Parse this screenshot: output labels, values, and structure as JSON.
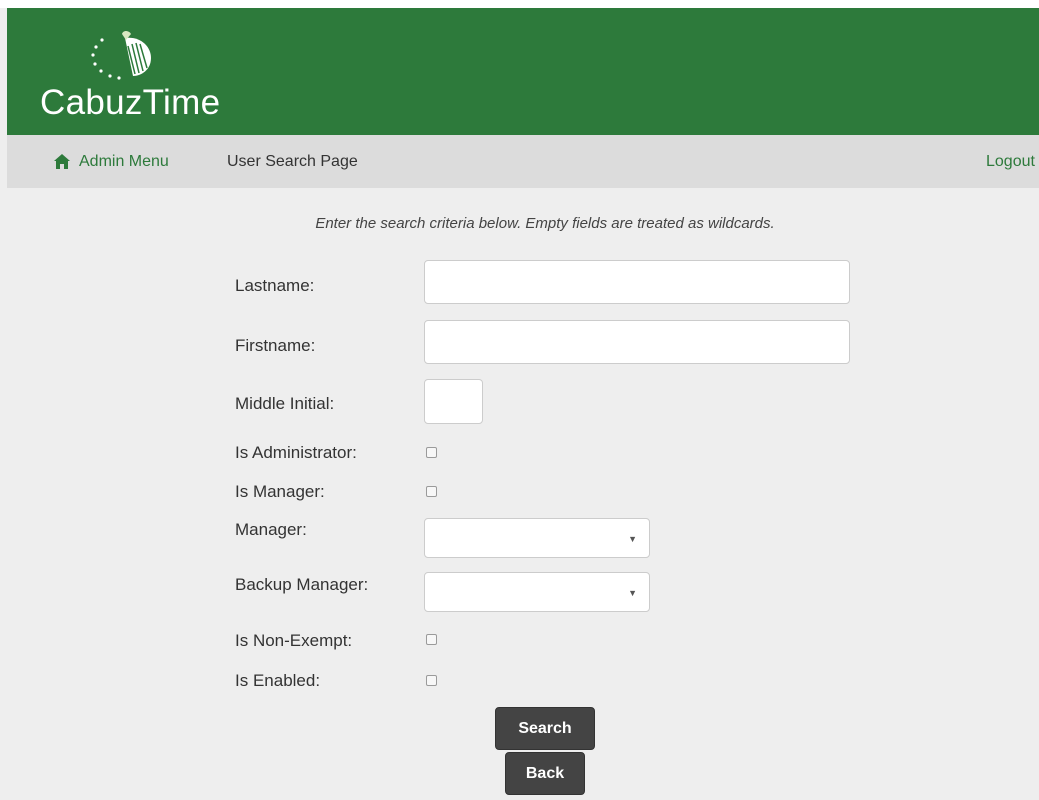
{
  "brand": {
    "name": "CabuzTime",
    "logo_icon": "cabuztime-logo-icon",
    "header_color": "#2d7a3b"
  },
  "nav": {
    "home_icon": "home-icon",
    "home_label": "Admin Menu",
    "page_title": "User Search Page",
    "logout_label": "Logout",
    "bar_color": "#dcdcdc"
  },
  "form": {
    "instructions": "Enter the search criteria below. Empty fields are treated as wildcards.",
    "lastname": {
      "label": "Lastname:",
      "value": ""
    },
    "firstname": {
      "label": "Firstname:",
      "value": ""
    },
    "middle_initial": {
      "label": "Middle Initial:",
      "value": ""
    },
    "is_administrator": {
      "label": "Is Administrator:",
      "checked": false
    },
    "is_manager": {
      "label": "Is Manager:",
      "checked": false
    },
    "manager": {
      "label": "Manager:",
      "selected": ""
    },
    "backup_manager": {
      "label": "Backup Manager:",
      "selected": ""
    },
    "is_non_exempt": {
      "label": "Is Non-Exempt:",
      "checked": false
    },
    "is_enabled": {
      "label": "Is Enabled:",
      "checked": false
    },
    "dropdown_icon": "chevron-down-icon"
  },
  "buttons": {
    "search_label": "Search",
    "back_label": "Back",
    "color": "#444444"
  }
}
